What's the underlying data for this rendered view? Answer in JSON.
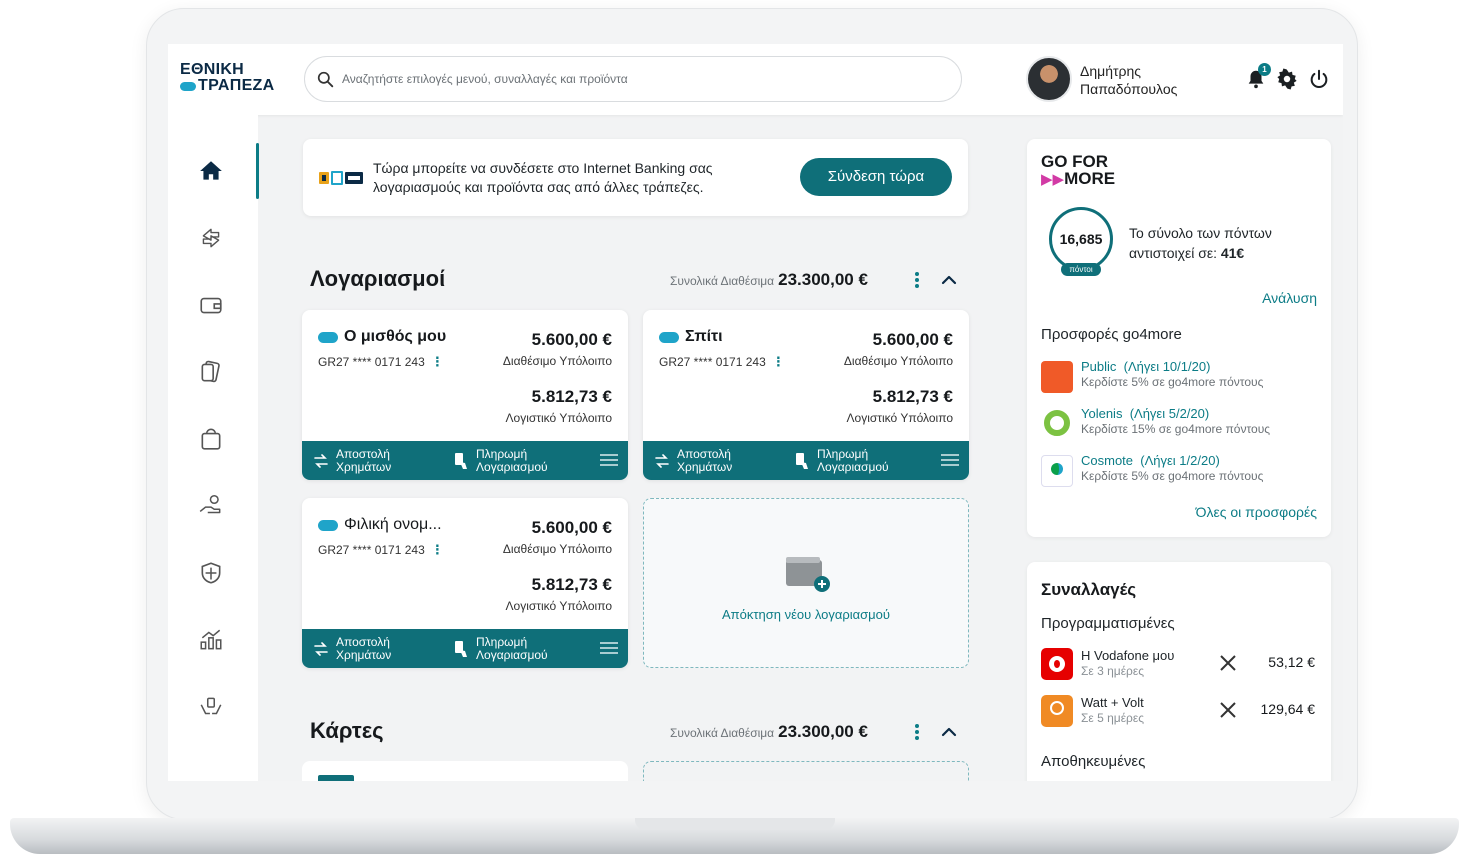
{
  "header": {
    "logo_line1": "ΕΘΝΙΚΗ",
    "logo_line2": "ΤΡΑΠΕΖΑ",
    "search_placeholder": "Αναζητήστε επιλογές μενού, συναλλαγές και προϊόντα",
    "user_first": "Δημήτρης",
    "user_last": "Παπαδόπουλος",
    "notification_count": "1"
  },
  "sidebar": {
    "items": [
      "home-icon",
      "transfer-icon",
      "wallet-icon",
      "cards-icon",
      "shopping-bag-icon",
      "loan-hand-icon",
      "shield-icon",
      "investments-icon",
      "insurance-hands-icon"
    ],
    "active": "home-icon"
  },
  "banner": {
    "text": "Τώρα μπορείτε να συνδέσετε στο Internet Banking σας λογαριασμούς και προϊόντα σας από άλλες τράπεζες.",
    "button": "Σύνδεση τώρα"
  },
  "accounts_section": {
    "title": "Λογαριασμοί",
    "total_label": "Συνολικά Διαθέσιμα",
    "total_value": "23.300,00 €"
  },
  "accounts": [
    {
      "name": "Ο μισθός μου",
      "iban": "GR27 **** 0171 243",
      "available": "5.600,00 €",
      "available_label": "Διαθέσιμο Υπόλοιπο",
      "ledger": "5.812,73 €",
      "ledger_label": "Λογιστικό Υπόλοιπο",
      "action1": "Αποστολή Χρημάτων",
      "action2": "Πληρωμή Λογαριασμού"
    },
    {
      "name": "Σπίτι",
      "iban": "GR27 **** 0171 243",
      "available": "5.600,00 €",
      "available_label": "Διαθέσιμο Υπόλοιπο",
      "ledger": "5.812,73 €",
      "ledger_label": "Λογιστικό Υπόλοιπο",
      "action1": "Αποστολή Χρημάτων",
      "action2": "Πληρωμή Λογαριασμού"
    },
    {
      "name": "Φιλική ονομ...",
      "iban": "GR27 **** 0171 243",
      "available": "5.600,00 €",
      "available_label": "Διαθέσιμο Υπόλοιπο",
      "ledger": "5.812,73 €",
      "ledger_label": "Λογιστικό Υπόλοιπο",
      "action1": "Αποστολή Χρημάτων",
      "action2": "Πληρωμή Λογαριασμού"
    }
  ],
  "new_account": {
    "label": "Απόκτηση νέου λογαριασμού"
  },
  "cards_section": {
    "title": "Κάρτες",
    "total_label": "Συνολικά Διαθέσιμα",
    "total_value": "23.300,00 €"
  },
  "go4more": {
    "logo_line1": "GO FOR",
    "logo_line2": "MORE",
    "points": "16,685",
    "points_unit": "πόντοι",
    "points_text_prefix": "Το σύνολο των πόντων αντιστοιχεί σε: ",
    "points_value": "41€",
    "analysis_link": "Ανάλυση",
    "offers_title": "Προσφορές go4more",
    "offers": [
      {
        "name": "Public",
        "expiry": "(Λήγει 10/1/20)",
        "desc": "Κερδίστε 5% σε go4more πόντους",
        "color": "#f05a28"
      },
      {
        "name": "Yolenis",
        "expiry": "(Λήγει 5/2/20)",
        "desc": "Κερδίστε 15% σε go4more πόντους",
        "color": "#7cc242"
      },
      {
        "name": "Cosmote",
        "expiry": "(Λήγει 1/2/20)",
        "desc": "Κερδίστε 5% σε go4more πόντους",
        "color": "#0aa04a"
      }
    ],
    "all_offers_link": "Όλες οι προσφορές"
  },
  "transactions": {
    "title": "Συναλλαγές",
    "scheduled_title": "Προγραμματισμένες",
    "scheduled": [
      {
        "name": "Η Vodafone μου",
        "when": "Σε 3 ημέρες",
        "amount": "53,12 €",
        "color": "#e60000"
      },
      {
        "name": "Watt + Volt",
        "when": "Σε 5 ημέρες",
        "amount": "129,64 €",
        "color": "#f08a24"
      }
    ],
    "saved_title": "Αποθηκευμένες"
  },
  "colors": {
    "primary": "#0f6f79",
    "accent": "#1fa4c9",
    "link": "#0c7c86"
  }
}
